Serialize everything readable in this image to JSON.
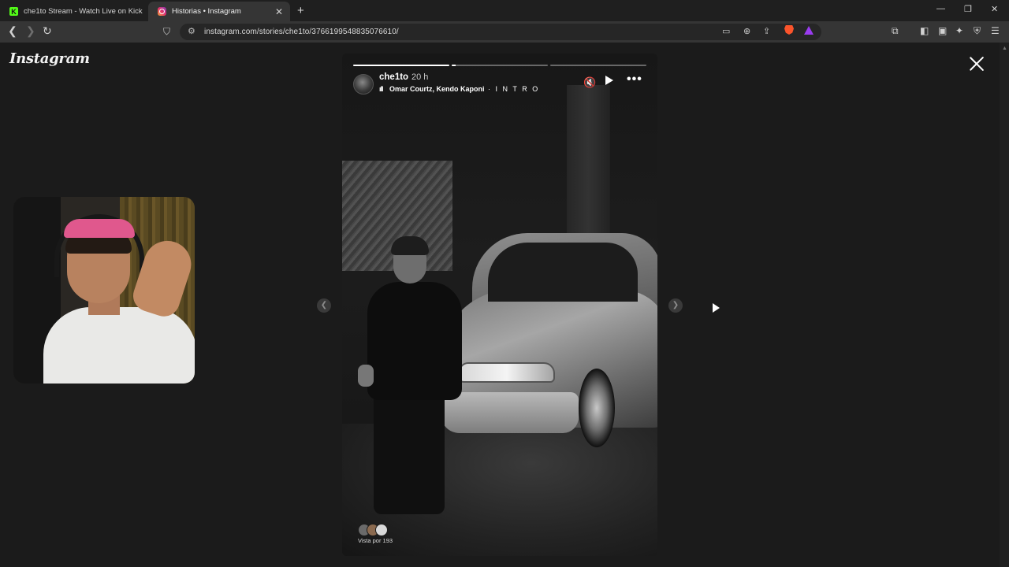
{
  "browser": {
    "tabs": [
      {
        "title": "che1to Stream - Watch Live on Kick",
        "favicon": "kick-icon"
      },
      {
        "title": "Historias • Instagram",
        "favicon": "instagram-icon",
        "active": true
      }
    ],
    "new_tab": "+",
    "url": "instagram.com/stories/che1to/3766199548835076610/",
    "window_controls": {
      "minimize": "—",
      "restore": "❐",
      "close": "✕"
    }
  },
  "page": {
    "logo": "Instagram",
    "close_label": "Close"
  },
  "story": {
    "username": "che1to",
    "time": "20 h",
    "music_artist": "Omar Courtz, Kendo Kaponi",
    "music_separator": " · ",
    "music_title": "I N T R O",
    "progress": [
      1.0,
      0.04,
      0.0
    ],
    "viewers_label": "Vista por 193",
    "accent": "#ffffff"
  },
  "icons": {
    "mute": "muted-speaker-icon",
    "play": "play-icon",
    "more": "more-options-icon"
  }
}
